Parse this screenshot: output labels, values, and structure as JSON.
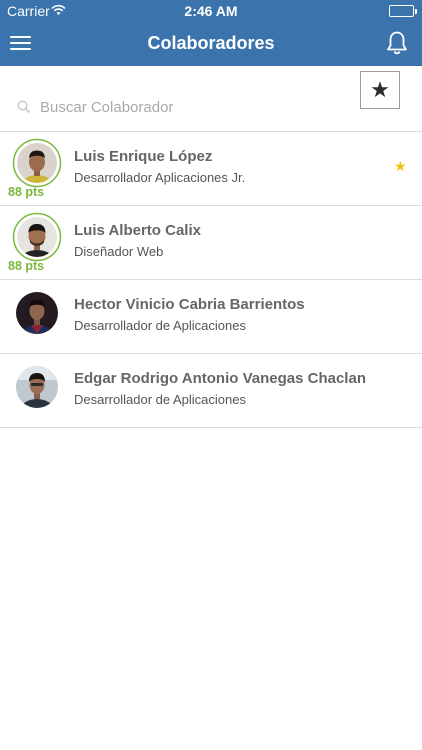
{
  "status_bar": {
    "carrier": "Carrier",
    "time": "2:46 AM"
  },
  "header": {
    "title": "Colaboradores"
  },
  "search": {
    "placeholder": "Buscar Colaborador",
    "value": ""
  },
  "favorites_button": {
    "icon": "★"
  },
  "collaborators": [
    {
      "name": "Luis Enrique López",
      "role": "Desarrollador Aplicaciones Jr.",
      "points": "88 pts",
      "favorite_icon": "★"
    },
    {
      "name": "Luis Alberto Calix",
      "role": "Diseñador Web",
      "points": "88 pts"
    },
    {
      "name": "Hector Vinicio Cabria Barrientos",
      "role": "Desarrollador de Aplicaciones"
    },
    {
      "name": "Edgar Rodrigo Antonio Vanegas Chaclan",
      "role": "Desarrollador de Aplicaciones"
    }
  ],
  "colors": {
    "header_bg": "#3b74ac",
    "points_green": "#7ab83c",
    "favorite_star": "#f4c20d",
    "divider": "#dcdcdc"
  }
}
